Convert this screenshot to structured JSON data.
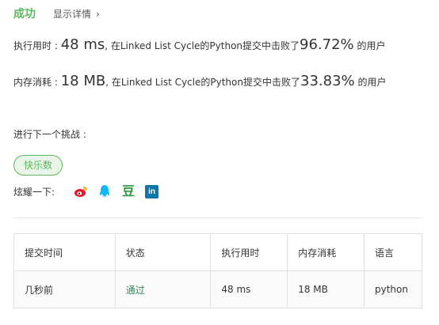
{
  "status": {
    "title": "成功",
    "detail_link": "显示详情"
  },
  "runtime": {
    "label": "执行用时 : ",
    "value": "48 ms",
    "sep": ", ",
    "text": "在Linked List Cycle的Python提交中击败了",
    "percent": "96.72%",
    "suffix": " 的用户"
  },
  "memory": {
    "label": "内存消耗 : ",
    "value": "18 MB",
    "sep": ", ",
    "text": "在Linked List Cycle的Python提交中击败了",
    "percent": "33.83%",
    "suffix": " 的用户"
  },
  "next": {
    "label": "进行下一个挑战 :",
    "tag": "快乐数"
  },
  "share": {
    "label": "炫耀一下:",
    "icons": [
      "weibo-icon",
      "qq-icon",
      "douban-icon",
      "linkedin-icon"
    ],
    "douban_glyph": "豆",
    "linkedin_glyph": "in"
  },
  "table": {
    "headers": [
      "提交时间",
      "状态",
      "执行用时",
      "内存消耗",
      "语言"
    ],
    "rows": [
      [
        "几秒前",
        "通过",
        "48 ms",
        "18 MB",
        "python"
      ]
    ]
  },
  "colors": {
    "success": "#5cb85c",
    "weibo": "#e6162d",
    "qq": "#12b7f5",
    "douban": "#2e963d",
    "linkedin": "#0e76a8"
  }
}
